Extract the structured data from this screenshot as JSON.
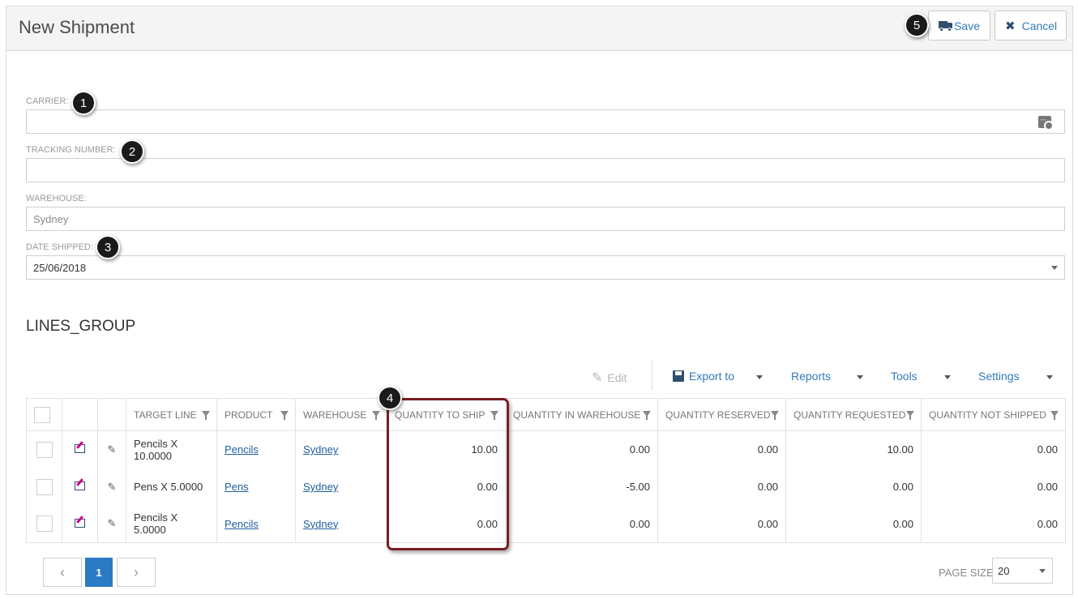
{
  "header": {
    "title": "New Shipment",
    "save_label": "Save",
    "cancel_label": "Cancel"
  },
  "callouts": [
    "1",
    "2",
    "3",
    "4",
    "5"
  ],
  "form": {
    "carrier_label": "CARRIER:",
    "carrier_value": "",
    "tracking_label": "TRACKING NUMBER:",
    "tracking_value": "",
    "warehouse_label": "WAREHOUSE:",
    "warehouse_value": "Sydney",
    "date_label": "DATE SHIPPED:",
    "date_value": "25/06/2018"
  },
  "section": {
    "title": "LINES_GROUP"
  },
  "toolbar": {
    "edit": "Edit",
    "export": "Export to",
    "reports": "Reports",
    "tools": "Tools",
    "settings": "Settings"
  },
  "grid": {
    "columns": [
      "TARGET LINE",
      "PRODUCT",
      "WAREHOUSE",
      "QUANTITY TO SHIP",
      "QUANTITY IN WAREHOUSE",
      "QUANTITY RESERVED",
      "QUANTITY REQUESTED",
      "QUANTITY NOT SHIPPED"
    ],
    "rows": [
      {
        "target": "Pencils X 10.0000",
        "product": "Pencils",
        "warehouse": "Sydney",
        "to_ship": "10.00",
        "in_wh": "0.00",
        "reserved": "0.00",
        "requested": "10.00",
        "not_shipped": "0.00"
      },
      {
        "target": "Pens X 5.0000",
        "product": "Pens",
        "warehouse": "Sydney",
        "to_ship": "0.00",
        "in_wh": "-5.00",
        "reserved": "0.00",
        "requested": "0.00",
        "not_shipped": "0.00"
      },
      {
        "target": "Pencils X 5.0000",
        "product": "Pencils",
        "warehouse": "Sydney",
        "to_ship": "0.00",
        "in_wh": "0.00",
        "reserved": "0.00",
        "requested": "0.00",
        "not_shipped": "0.00"
      }
    ]
  },
  "pager": {
    "prev": "‹",
    "current": "1",
    "next": "›",
    "page_size_label": "PAGE SIZE",
    "page_size": "20"
  },
  "colors": {
    "accent": "#337ab7",
    "highlight": "#7a1f22",
    "pager_active": "#2b7bc4"
  }
}
